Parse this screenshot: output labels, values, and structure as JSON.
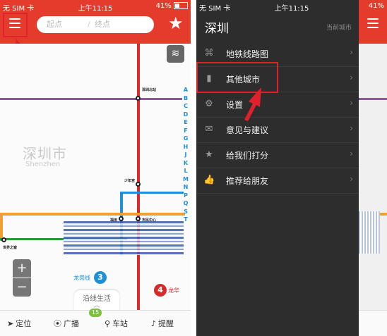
{
  "colors": {
    "header_red": "#e53b2c",
    "line_red": "#d52b2b",
    "line_orange": "#f0a030",
    "line_blue": "#1f8fd6",
    "line_purple": "#8a5aa6",
    "line_green": "#2a9a3c",
    "drawer_bg": "#2d2d2d",
    "highlight_red": "#e0202a"
  },
  "status_bar": {
    "carrier": "无 SIM 卡",
    "time": "上午11:15",
    "battery": "41%"
  },
  "left_screen": {
    "search": {
      "start_placeholder": "起点",
      "end_placeholder": "终点"
    },
    "icons": {
      "menu": "menu-icon",
      "favorite": "star-icon",
      "layers": "layers-icon"
    },
    "map": {
      "city_name_cn": "深圳市",
      "city_name_en": "Shenzhen",
      "stations": {
        "s1": "深圳北站",
        "s2": "少年宫",
        "s3": "市民中心",
        "s4": "世界之窗",
        "s5": "福田",
        "s6": "龙华"
      },
      "alphabet": [
        "A",
        "B",
        "C",
        "D",
        "E",
        "F",
        "G",
        "H",
        "J",
        "K",
        "L",
        "M",
        "N",
        "P",
        "Q",
        "S",
        "T"
      ],
      "line_badges": [
        {
          "text": "3",
          "label": "龙岗线"
        },
        {
          "text": "4",
          "label": "龙华"
        }
      ]
    },
    "zoom_in": "+",
    "zoom_out": "−",
    "pull_tab": "沿线生活",
    "tabs": [
      {
        "icon": "location-arrow-icon",
        "glyph": "➤",
        "label": "定位"
      },
      {
        "icon": "broadcast-icon",
        "glyph": "📡",
        "label": "广播",
        "count": "15"
      },
      {
        "icon": "station-pin-icon",
        "glyph": "⚲",
        "label": "车站"
      },
      {
        "icon": "bell-icon",
        "glyph": "🔔",
        "label": "提醒"
      }
    ]
  },
  "right_screen": {
    "drawer": {
      "city": "深圳",
      "current_city_label": "当前城市",
      "items": [
        {
          "icon": "metro-map-icon",
          "glyph": "⌘",
          "label": "地铁线路图"
        },
        {
          "icon": "city-buildings-icon",
          "glyph": "▮",
          "label": "其他城市"
        },
        {
          "icon": "gear-icon",
          "glyph": "⚙",
          "label": "设置"
        },
        {
          "icon": "mail-icon",
          "glyph": "✉",
          "label": "意见与建议"
        },
        {
          "icon": "star-icon",
          "glyph": "★",
          "label": "给我们打分"
        },
        {
          "icon": "thumbs-up-icon",
          "glyph": "👍",
          "label": "推荐给朋友"
        }
      ],
      "chevron": "›"
    }
  }
}
